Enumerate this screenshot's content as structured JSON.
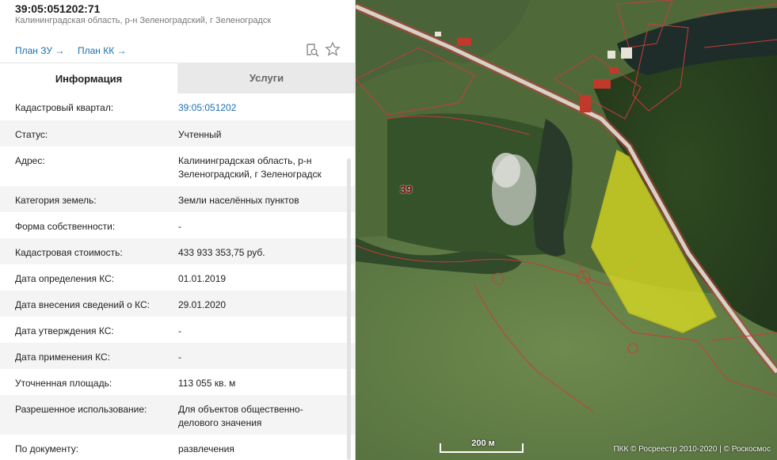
{
  "header": {
    "cadastral_number": "39:05:051202:71",
    "address_short": "Калининградская область, р-н Зеленоградский, г Зеленоградск",
    "plan_zu_label": "План ЗУ →",
    "plan_kk_label": "План КК →"
  },
  "tabs": {
    "info_label": "Информация",
    "services_label": "Услуги"
  },
  "rows": [
    {
      "label": "Кадастровый квартал:",
      "value": "39:05:051202"
    },
    {
      "label": "Статус:",
      "value": "Учтенный"
    },
    {
      "label": "Адрес:",
      "value": "Калининградская область, р-н Зеленоградский, г Зеленоградск"
    },
    {
      "label": "Категория земель:",
      "value": "Земли населённых пунктов"
    },
    {
      "label": "Форма собственности:",
      "value": "-"
    },
    {
      "label": "Кадастровая стоимость:",
      "value": "433 933 353,75 руб."
    },
    {
      "label": "Дата определения КС:",
      "value": "01.01.2019"
    },
    {
      "label": "Дата внесения сведений о КС:",
      "value": "29.01.2020"
    },
    {
      "label": "Дата утверждения КС:",
      "value": "-"
    },
    {
      "label": "Дата применения КС:",
      "value": "-"
    },
    {
      "label": "Уточненная площадь:",
      "value": "113 055 кв. м"
    },
    {
      "label": "Разрешенное использование:",
      "value": "Для объектов общественно-делового значения"
    },
    {
      "label": "По документу:",
      "value": "развлечения"
    }
  ],
  "map": {
    "quarter_label": "39",
    "scale_label": "200 м",
    "credit": "ПКК © Росреестр 2010-2020 | © Роскосмос",
    "colors": {
      "parcel_fill": "#e6e61e",
      "boundary": "#c83c3c",
      "road": "#d7d2c8",
      "water": "#1e2d2a"
    }
  },
  "icons": {
    "search_doc": "search-document-icon",
    "favorite": "star-icon"
  }
}
